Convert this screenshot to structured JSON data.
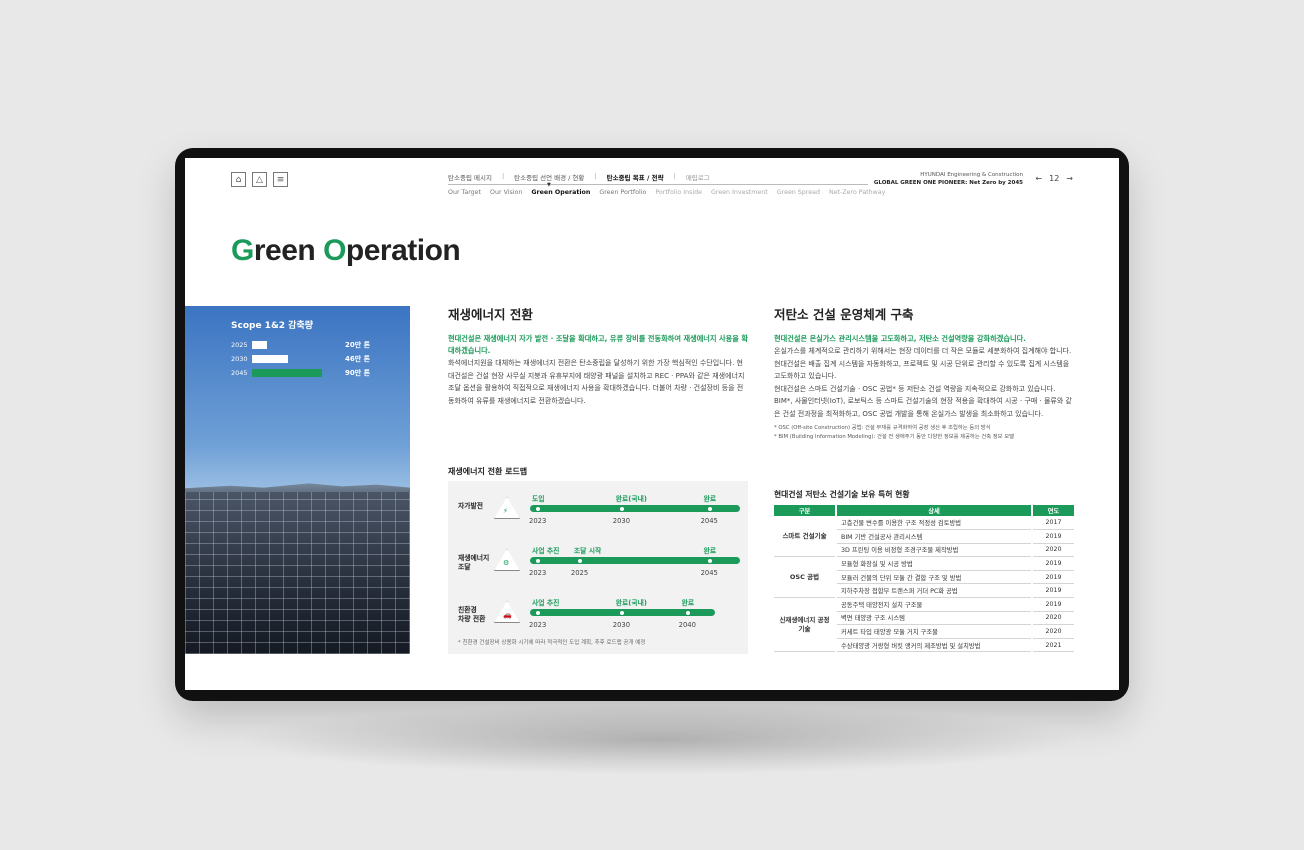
{
  "nav": {
    "tabs": [
      "탄소중립 메시지",
      "탄소중립 선언 배경 / 현황",
      "탄소중립 목표 / 전략",
      "매립로그"
    ],
    "subtabs": [
      "Our Target",
      "Our Vision",
      "Green Operation",
      "Green Portfolio",
      "Portfolio Inside",
      "Green Investment",
      "Green Spread",
      "Net-Zero Pathway"
    ]
  },
  "brand": {
    "line1": "HYUNDAI Engineering & Construction",
    "line2": "GLOBAL GREEN ONE PIONEER: Net Zero by 2045"
  },
  "pager": {
    "prev": "←",
    "page": "12",
    "next": "→"
  },
  "page": {
    "title_g": "G",
    "title_1": "reen ",
    "title_o": "O",
    "title_2": "peration"
  },
  "scope": {
    "title": "Scope 1&2 감축량",
    "rows": [
      {
        "year": "2025",
        "value": "20만 톤",
        "fraction": 0.22
      },
      {
        "year": "2030",
        "value": "46만 톤",
        "fraction": 0.51
      },
      {
        "year": "2045",
        "value": "90만 톤",
        "fraction": 1.0
      }
    ]
  },
  "renew": {
    "title": "재생에너지 전환",
    "lead": "현대건설은 재생에너지 자가 발전 · 조달을 확대하고, 유류 장비를 전동화하여 재생에너지 사용을 확대하겠습니다.",
    "body": "화석에너지원을 대체하는 재생에너지 전환은 탄소중립을 달성하기 위한 가장 핵심적인 수단입니다. 현대건설은 건설 현장 사무실 지붕과 유휴부지에 태양광 패널을 설치하고 REC · PPA와 같은 재생에너지 조달 옵션을 활용하여 직접적으로 재생에너지 사용을 확대하겠습니다. 더불어 차량 · 건설장비 등을 전동화하여 유류를 재생에너지로 전환하겠습니다."
  },
  "roadmap": {
    "title": "재생에너지 전환 로드맵",
    "rows": [
      {
        "label1": "자가발전",
        "label2": "",
        "icon": "⚡",
        "stages": [
          {
            "text": "도입",
            "pos": 0.0
          },
          {
            "text": "완료(국내)",
            "pos": 0.42
          },
          {
            "text": "완료",
            "pos": 0.86
          }
        ],
        "years": [
          {
            "text": "2023",
            "pos": 0.0
          },
          {
            "text": "2030",
            "pos": 0.42
          },
          {
            "text": "2045",
            "pos": 0.86
          }
        ]
      },
      {
        "label1": "재생에너지",
        "label2": "조달",
        "icon": "⚙",
        "stages": [
          {
            "text": "사업 추진",
            "pos": 0.0
          },
          {
            "text": "조달 시작",
            "pos": 0.21
          },
          {
            "text": "완료",
            "pos": 0.86
          }
        ],
        "years": [
          {
            "text": "2023",
            "pos": 0.0
          },
          {
            "text": "2025",
            "pos": 0.21
          },
          {
            "text": "2045",
            "pos": 0.86
          }
        ]
      },
      {
        "label1": "친환경",
        "label2": "차량 전환",
        "icon": "🚗",
        "stages": [
          {
            "text": "사업 추진",
            "pos": 0.0
          },
          {
            "text": "완료(국내)",
            "pos": 0.42
          },
          {
            "text": "완료",
            "pos": 0.75
          }
        ],
        "years": [
          {
            "text": "2023",
            "pos": 0.0
          },
          {
            "text": "2030",
            "pos": 0.42
          },
          {
            "text": "2040",
            "pos": 0.75
          }
        ]
      }
    ],
    "note": "* 친환경 건설장비 상용화 시기에 따라 적극적인 도입 계획, 추후 로드맵 공개 예정"
  },
  "lowcarbon": {
    "title": "저탄소 건설 운영체계 구축",
    "lead": "현대건설은 온실가스 관리시스템을 고도화하고, 저탄소 건설역량을 강화하겠습니다.",
    "body1": "온실가스를 체계적으로 관리하기 위해서는 현장 데이터를 더 작은 모듈로 세분화하여 집계해야 합니다. 현대건설은 배출 집계 시스템을 자동화하고, 프로젝트 및 시공 단위로 관리할 수 있도록 집계 시스템을 고도화하고 있습니다.",
    "body2": "현대건설은 스마트 건설기술 · OSC 공법* 등 저탄소 건설 역량을 지속적으로 강화하고 있습니다. BIM*, 사물인터넷(IoT), 로보틱스 등 스마트 건설기술의 현장 적용을 확대하여 시공 · 구매 · 물류와 같은 건설 전과정을 최적화하고, OSC 공법 개발을 통해 온실가스 발생을 최소화하고 있습니다.",
    "note1": "* OSC (Off-site Construction) 공법: 건설 부재를 규격화하여 공장 생산 후 조립하는 등의 방식",
    "note2": "* BIM (Building Information Modeling): 건설 전 생애주기 동안 다양한 정보를 제공하는 건축 정보 모델"
  },
  "patents": {
    "title": "현대건설 저탄소 건설기술 보유 특허 현황",
    "headers": [
      "구분",
      "상세",
      "연도"
    ],
    "groups": [
      {
        "category": "스마트 건설기술",
        "items": [
          {
            "detail": "고층건물 변수를 이용한 구조 적정성 검토방법",
            "year": "2017"
          },
          {
            "detail": "BIM 기반 건설공사 관리시스템",
            "year": "2019"
          },
          {
            "detail": "3D 프린팅 이용 비정형 조경구조물 제작방법",
            "year": "2020"
          }
        ]
      },
      {
        "category": "OSC 공법",
        "items": [
          {
            "detail": "모듈형 화장실 및 시공 방법",
            "year": "2019"
          },
          {
            "detail": "모듈러 건물의 단위 모듈 간 결합 구조 및 방법",
            "year": "2019"
          },
          {
            "detail": "지하주차장 접합부 트랜스퍼 거더 PC화 공법",
            "year": "2019"
          }
        ]
      },
      {
        "category": "신재생에너지 공정기술",
        "items": [
          {
            "detail": "공동주택 태양전지 설치 구조물",
            "year": "2019"
          },
          {
            "detail": "벽면 태양광 구조 시스템",
            "year": "2020"
          },
          {
            "detail": "커세트 타입 태양광 모듈 거치 구조물",
            "year": "2020"
          },
          {
            "detail": "수상태양광 거랑형 버킷 앵커의 제조방법 및 설치방법",
            "year": "2021"
          }
        ]
      }
    ]
  },
  "colors": {
    "accent": "#1b9a5a"
  }
}
